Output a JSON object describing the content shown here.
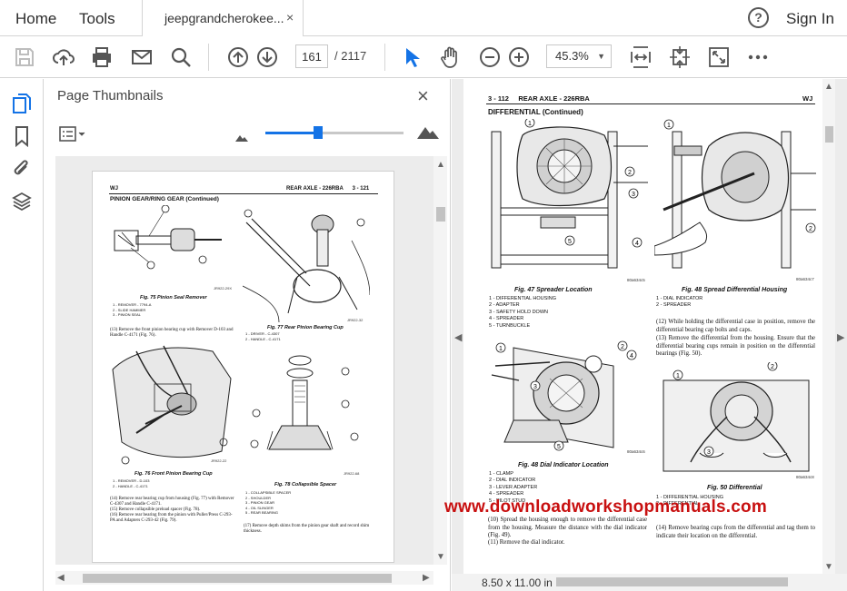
{
  "tabbar": {
    "home": "Home",
    "tools": "Tools",
    "doc_tab": "jeepgrandcherokee...",
    "close_glyph": "×",
    "help_glyph": "?",
    "sign_in": "Sign In"
  },
  "toolbar": {
    "icons": [
      "save-icon",
      "upload-icon",
      "print-icon",
      "email-icon",
      "search-icon",
      "page-up-icon",
      "page-down-icon",
      "select-cursor-icon",
      "hand-icon",
      "zoom-out-icon",
      "zoom-in-icon",
      "fit-width-icon",
      "fit-page-icon",
      "full-screen-icon",
      "more-icon"
    ],
    "page_current": "161",
    "page_total": "/  2117",
    "zoom": "45.3%",
    "accent": "#1473e6"
  },
  "leftrail": {
    "icons": [
      "pages-icon",
      "bookmark-icon",
      "attachment-icon",
      "layers-icon"
    ]
  },
  "thumb_panel": {
    "title": "Page Thumbnails",
    "close_glyph": "×",
    "thumb_size_level": 0.38,
    "page": {
      "header_left": "WJ",
      "header_right": "REAR AXLE - 226RBA      3 - 121",
      "section": "PINION GEAR/RING GEAR (Continued)",
      "fig75_caption": "Fig. 75 Pinion Seal Remover",
      "fig75_legend": [
        "1 - REMOVER - 7794-A",
        "2 - SLIDE HAMMER",
        "3 - PINION SEAL"
      ],
      "fig75_code": "JR922-29X",
      "fig77_caption": "Fig. 77 Rear Pinion Bearing Cup",
      "fig77_legend": [
        "1 - DRIVER - C-4307",
        "2 - HANDLE - C-4171"
      ],
      "fig77_code": "JR922-32",
      "para13": "(13) Remove the front pinion bearing cup with Remover D-103 and Handle C-4171 (Fig. 76).",
      "fig76_caption": "Fig. 76 Front Pinion Bearing Cup",
      "fig76_legend": [
        "1 - REMOVER - D-103",
        "2 - HANDLE - C-4171"
      ],
      "fig76_code": "JR922-22",
      "fig78_caption": "Fig. 78 Collapsible Spacer",
      "fig78_legend": [
        "1 - COLLAPSIBLE SPACER",
        "2 - SHOULDER",
        "3 - PINION GEAR",
        "4 - OIL SLINGER",
        "5 - REAR BEARING"
      ],
      "fig78_code": "JR922-68",
      "para14": "(14) Remove rear bearing cup from housing (Fig. 77) with Remover C-4307 and Handle C-4171.",
      "para15": "(15) Remove collapsible preload spacer (Fig. 78).",
      "para16": "(16) Remove rear bearing from the pinion with Puller/Press C-293-PA and Adapters C-293-42 (Fig. 79).",
      "para17": "(17) Remove depth shims from the pinion gear shaft and record shim thickness."
    }
  },
  "doc_page": {
    "header_left": "3 - 112     REAR AXLE - 226RBA",
    "header_right": "WJ",
    "section": "DIFFERENTIAL (Continued)",
    "fig47_caption": "Fig. 47 Spreader Location",
    "fig47_code": "80a634c5",
    "fig47_legend": [
      "1 - DIFFERENTIAL HOUSING",
      "2 - ADAPTER",
      "3 - SAFETY HOLD DOWN",
      "4 - SPREADER",
      "5 - TURNBUCKLE"
    ],
    "fig48a_caption": "Fig. 48 Spread Differential Housing",
    "fig48a_code": "80a634c7",
    "fig48a_legend": [
      "1 - DIAL INDICATOR",
      "2 - SPREADER"
    ],
    "para12": "(12) While holding the differential case in position, remove the differential bearing cap bolts and caps.",
    "para13": "(13) Remove the differential from the housing. Ensure that the differential bearing cups remain in position on the differential bearings (Fig. 50).",
    "fig48b_caption": "Fig. 48 Dial Indicator Location",
    "fig48b_code": "80a634c6",
    "fig48b_legend": [
      "1 - CLAMP",
      "2 - DIAL INDICATOR",
      "3 - LEVER ADAPTER",
      "4 - SPREADER",
      "5 - PILOT STUD"
    ],
    "fig50_caption": "Fig. 50 Differential",
    "fig50_code": "80a634c8",
    "fig50_legend": [
      "1 - DIFFERENTIAL HOUSING",
      "2 - DIFFERENTIAL"
    ],
    "para10": "(10) Spread the housing enough to remove the differential case from the housing. Measure the distance with the dial indicator (Fig. 49).",
    "para11": "(11) Remove the dial indicator.",
    "para14": "(14) Remove bearing cups from the differential and tag them to indicate their location on the differential."
  },
  "status": {
    "page_size": "8.50 x 11.00 in"
  },
  "watermark": "www.downloadworkshopmanuals.com"
}
